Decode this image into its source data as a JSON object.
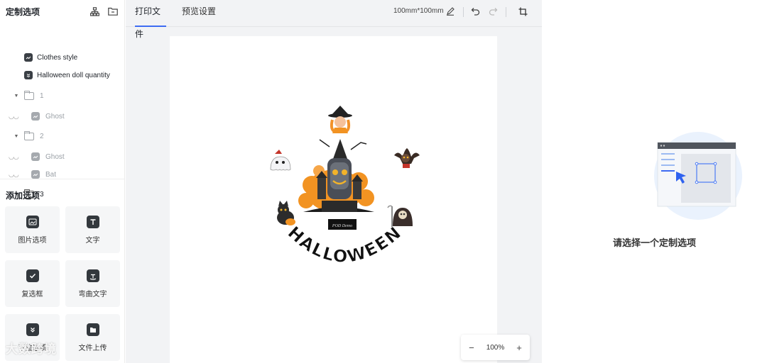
{
  "left": {
    "title": "定制选项",
    "tree": [
      {
        "label": "Clothes style",
        "kind": "image"
      },
      {
        "label": "Halloween doll quantity",
        "kind": "check"
      },
      {
        "label": "1",
        "kind": "folder"
      },
      {
        "label": "Ghost",
        "kind": "image-hidden"
      },
      {
        "label": "2",
        "kind": "folder"
      },
      {
        "label": "Ghost",
        "kind": "image-hidden"
      },
      {
        "label": "Bat",
        "kind": "image-hidden"
      },
      {
        "label": "3",
        "kind": "folder-open"
      }
    ],
    "add_title": "添加选项",
    "tiles": [
      {
        "label": "图片选项",
        "icon": "image-icon"
      },
      {
        "label": "文字",
        "icon": "text-icon"
      },
      {
        "label": "复选框",
        "icon": "checkbox-icon"
      },
      {
        "label": "弯曲文字",
        "icon": "curved-text-icon"
      },
      {
        "label": "下拉选项",
        "icon": "dropdown-icon"
      },
      {
        "label": "文件上传",
        "icon": "file-upload-icon"
      }
    ]
  },
  "toolbar": {
    "tabs": [
      "打印文件",
      "预览设置"
    ],
    "size": "100mm*100mm"
  },
  "canvas": {
    "arc_text": "HALLOWEEN",
    "badge_text": "POD Demo"
  },
  "zoom": {
    "minus": "−",
    "value": "100%",
    "plus": "+"
  },
  "right": {
    "empty_text": "请选择一个定制选项"
  },
  "watermark": "大数跨境",
  "colors": {
    "accent": "#3d6bf2",
    "orange": "#f29322"
  }
}
